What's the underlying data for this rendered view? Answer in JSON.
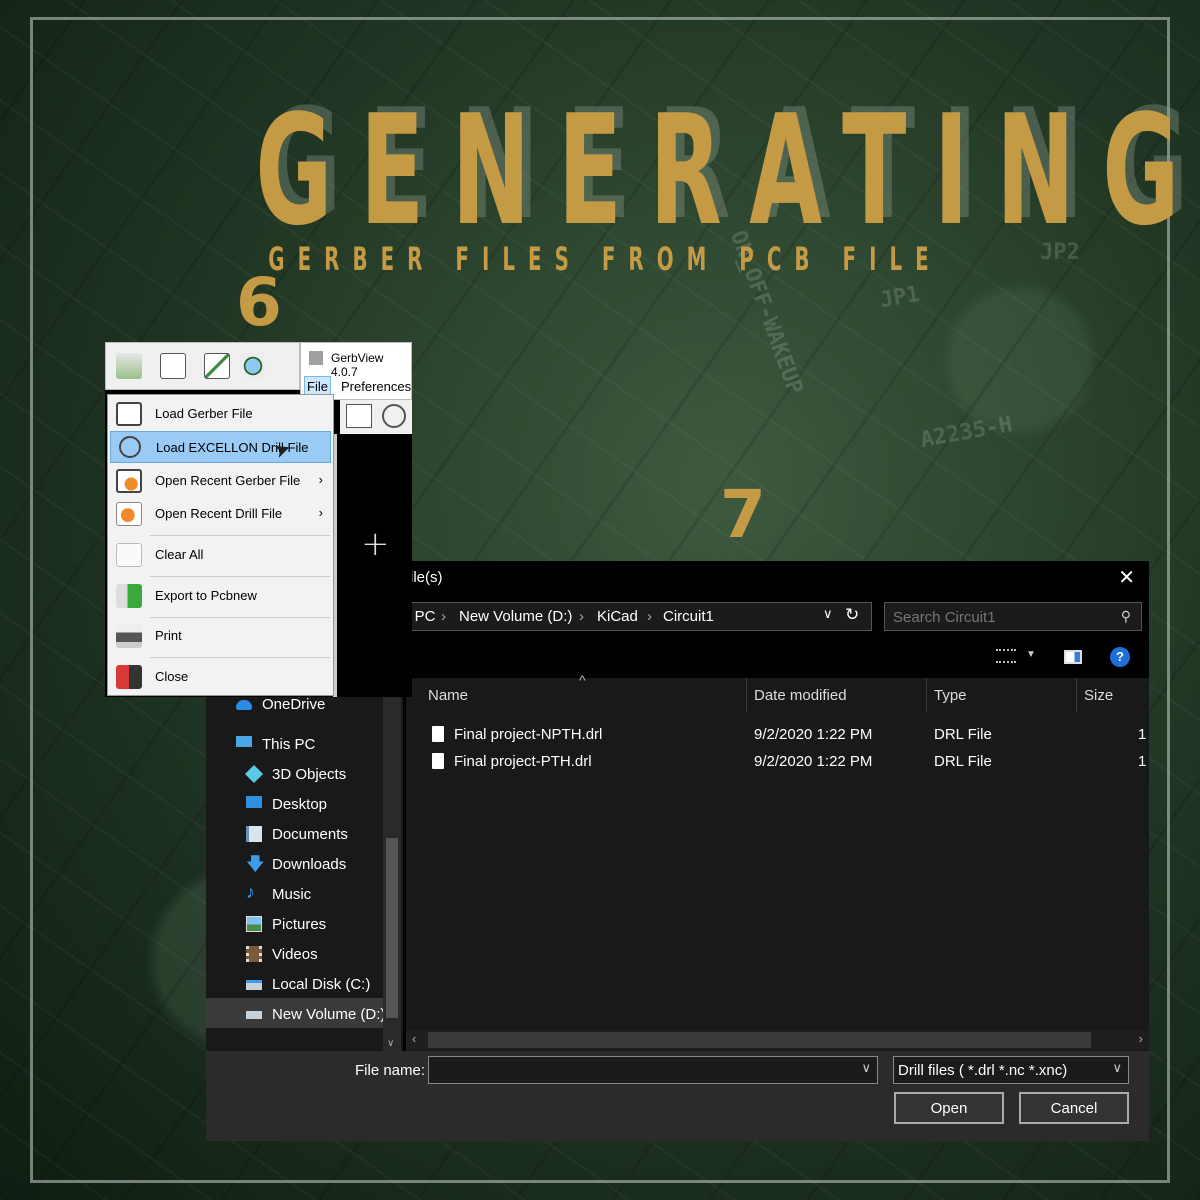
{
  "hero": {
    "title": "GENERATING",
    "subtitle": "GERBER FILES FROM PCB FILE",
    "step6": "6",
    "step7": "7"
  },
  "colors": {
    "accent_gold": "#c59a45",
    "selection_blue": "#99cbf5",
    "dialog_bg": "#191919"
  },
  "gerbview": {
    "window_title": "GerbView 4.0.7",
    "menu_file": "File",
    "menu_preferences": "Preferences",
    "file_menu": [
      {
        "label": "Load Gerber File",
        "icon": "gerber-icon"
      },
      {
        "label": "Load EXCELLON Drill File",
        "icon": "drill-target-icon",
        "highlighted": true
      },
      {
        "label": "Open Recent Gerber File",
        "icon": "recent-gerber-icon",
        "submenu": "›"
      },
      {
        "label": "Open Recent Drill File",
        "icon": "recent-drill-icon",
        "submenu": "›"
      },
      {
        "label": "Clear All",
        "icon": "clear-icon"
      },
      {
        "label": "Export to Pcbnew",
        "icon": "export-icon"
      },
      {
        "label": "Print",
        "icon": "printer-icon"
      },
      {
        "label": "Close",
        "icon": "exit-icon"
      }
    ]
  },
  "dialog": {
    "title": "ile(s)",
    "close": "✕",
    "address": {
      "parts": [
        "s PC",
        "New Volume (D:)",
        "KiCad",
        "Circuit1"
      ],
      "separator": "›"
    },
    "search_placeholder": "Search Circuit1",
    "columns": [
      "Name",
      "Date modified",
      "Type",
      "Size"
    ],
    "sort_arrow": "^",
    "files": [
      {
        "name": "Final project-NPTH.drl",
        "date": "9/2/2020 1:22 PM",
        "type": "DRL File",
        "size": "1"
      },
      {
        "name": "Final project-PTH.drl",
        "date": "9/2/2020 1:22 PM",
        "type": "DRL File",
        "size": "1"
      }
    ],
    "sidebar": [
      {
        "label": "OneDrive",
        "icon": "cloud-icon"
      },
      {
        "label": "This PC",
        "icon": "computer-icon"
      },
      {
        "label": "3D Objects",
        "icon": "cube-icon"
      },
      {
        "label": "Desktop",
        "icon": "desktop-icon"
      },
      {
        "label": "Documents",
        "icon": "documents-icon"
      },
      {
        "label": "Downloads",
        "icon": "download-arrow-icon"
      },
      {
        "label": "Music",
        "icon": "music-note-icon"
      },
      {
        "label": "Pictures",
        "icon": "pictures-icon"
      },
      {
        "label": "Videos",
        "icon": "film-icon"
      },
      {
        "label": "Local Disk (C:)",
        "icon": "disk-icon"
      },
      {
        "label": "New Volume (D:)",
        "icon": "drive-icon",
        "selected": true
      }
    ],
    "filename_label": "File name:",
    "filename_value": "",
    "filter_value": "Drill files ( *.drl *.nc *.xnc)",
    "open_button": "Open",
    "cancel_button": "Cancel",
    "help": "?"
  }
}
